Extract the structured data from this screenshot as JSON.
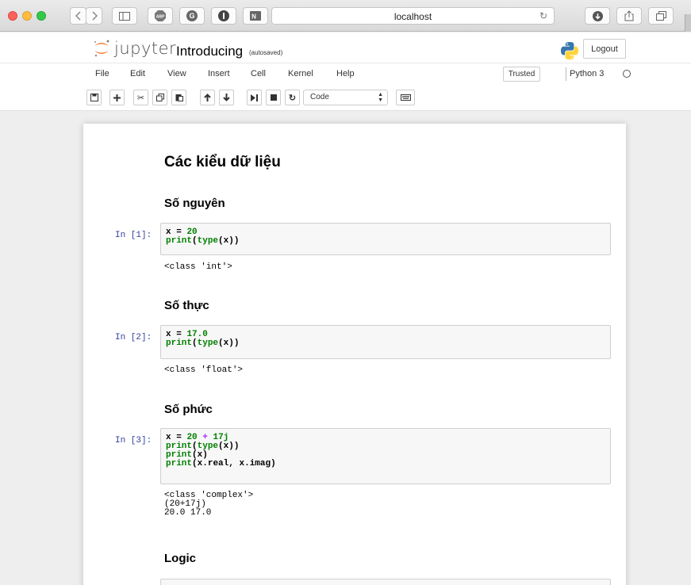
{
  "browser": {
    "url": "localhost",
    "buttons": [
      "back",
      "forward",
      "sidebar",
      "abp",
      "grammarly",
      "onepass",
      "onenote"
    ]
  },
  "header": {
    "logo_text": "jupyter",
    "notebook_title": "Introducing",
    "autosave_status": "(autosaved)",
    "logout_label": "Logout"
  },
  "menu": {
    "items": [
      "File",
      "Edit",
      "View",
      "Insert",
      "Cell",
      "Kernel",
      "Help"
    ],
    "trusted_label": "Trusted",
    "kernel_name": "Python 3"
  },
  "toolbar": {
    "cell_type": "Code"
  },
  "notebook": {
    "h1": "Các kiểu dữ liệu",
    "sections": [
      {
        "heading": "Số nguyên",
        "prompt": "In [1]:",
        "code": [
          "x = 20",
          "print(type(x))"
        ],
        "output": [
          "<class 'int'>"
        ]
      },
      {
        "heading": "Số thực",
        "prompt": "In [2]:",
        "code": [
          "x = 17.0",
          "print(type(x))"
        ],
        "output": [
          "<class 'float'>"
        ]
      },
      {
        "heading": "Số phức",
        "prompt": "In [3]:",
        "code": [
          "x = 20 + 17j",
          "print(type(x))",
          "print(x)",
          "print(x.real, x.imag)"
        ],
        "output": [
          "<class 'complex'>",
          "(20+17j)",
          "20.0 17.0"
        ]
      },
      {
        "heading": "Logic"
      }
    ]
  },
  "colors": {
    "prompt_in": "#303f9f",
    "keyword_green": "#008000",
    "operator_purple": "#aa22ff",
    "cell_background": "#f7f7f7"
  }
}
